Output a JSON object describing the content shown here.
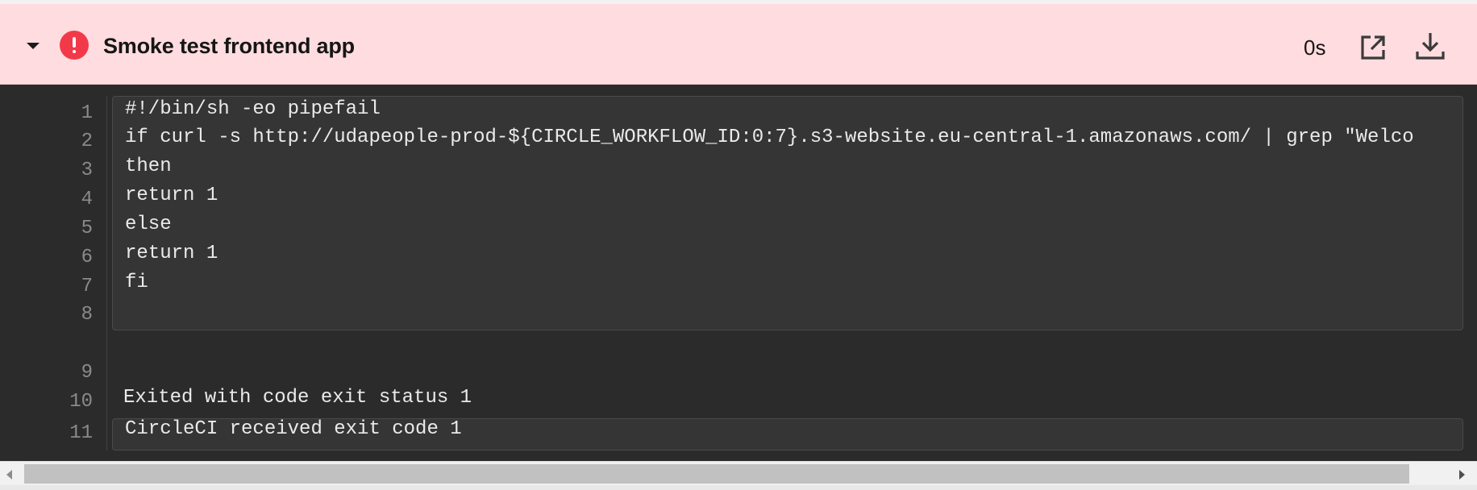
{
  "step": {
    "title": "Smoke test frontend app",
    "duration": "0s",
    "status": "failed",
    "status_color": "#f2394a",
    "header_bg": "#ffdcdf",
    "icons": {
      "toggle": "caret-down-icon",
      "status": "exclamation-circle-icon",
      "open": "open-in-new-icon",
      "download": "download-icon"
    }
  },
  "output": {
    "command_lines": [
      {
        "n": "1",
        "text": "#!/bin/sh -eo pipefail"
      },
      {
        "n": "2",
        "text": "if curl -s http://udapeople-prod-${CIRCLE_WORKFLOW_ID:0:7}.s3-website.eu-central-1.amazonaws.com/ | grep \"Welco"
      },
      {
        "n": "3",
        "text": "then"
      },
      {
        "n": "4",
        "text": "return 1"
      },
      {
        "n": "5",
        "text": "else"
      },
      {
        "n": "6",
        "text": "return 1"
      },
      {
        "n": "7",
        "text": "fi"
      },
      {
        "n": "8",
        "text": ""
      }
    ],
    "log_lines": [
      {
        "n": "9",
        "text": ""
      },
      {
        "n": "10",
        "text": "Exited with code exit status 1"
      }
    ],
    "final_line": {
      "n": "11",
      "text": "CircleCI received exit code 1"
    }
  }
}
